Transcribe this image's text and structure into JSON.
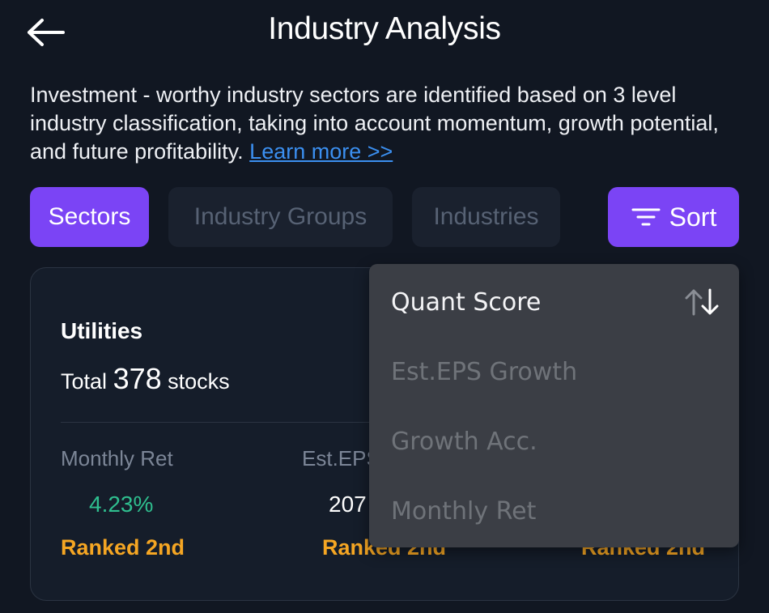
{
  "header": {
    "title": "Industry Analysis",
    "back_icon": "arrow-left-icon"
  },
  "description": {
    "text": "Investment - worthy industry sectors are identified based on 3 level industry classification, taking into account momentum, growth potential, and future profitability.",
    "link_label": "Learn more >>"
  },
  "tabs": [
    {
      "label": "Sectors",
      "active": true
    },
    {
      "label": "Industry Groups",
      "active": false
    },
    {
      "label": "Industries",
      "active": false
    }
  ],
  "sort": {
    "label": "Sort",
    "icon": "filter-lines-icon"
  },
  "card": {
    "title": "Utilities",
    "total_prefix": "Total",
    "total_count": "378",
    "total_suffix": "stocks",
    "metrics": [
      {
        "label": "Monthly Ret",
        "value": "4.23%",
        "rank": "Ranked 2nd",
        "value_color": "#2fbf8f"
      },
      {
        "label": "Est.EPS Growth",
        "value": "207",
        "rank": "Ranked 2nd",
        "value_color": "#ffffff"
      },
      {
        "label": "",
        "value": "",
        "rank": "Ranked 2nd",
        "value_color": "#ffffff"
      }
    ]
  },
  "sort_menu": {
    "items": [
      {
        "label": "Quant Score",
        "selected": true
      },
      {
        "label": "Est.EPS Growth",
        "selected": false
      },
      {
        "label": "Growth Acc.",
        "selected": false
      },
      {
        "label": "Monthly Ret",
        "selected": false
      }
    ],
    "selected_icon": "sort-arrows-icon"
  },
  "colors": {
    "background": "#111722",
    "accent": "#7b44f5",
    "link": "#3b8ff0",
    "positive": "#2fbf8f",
    "rank": "#f5a623"
  }
}
